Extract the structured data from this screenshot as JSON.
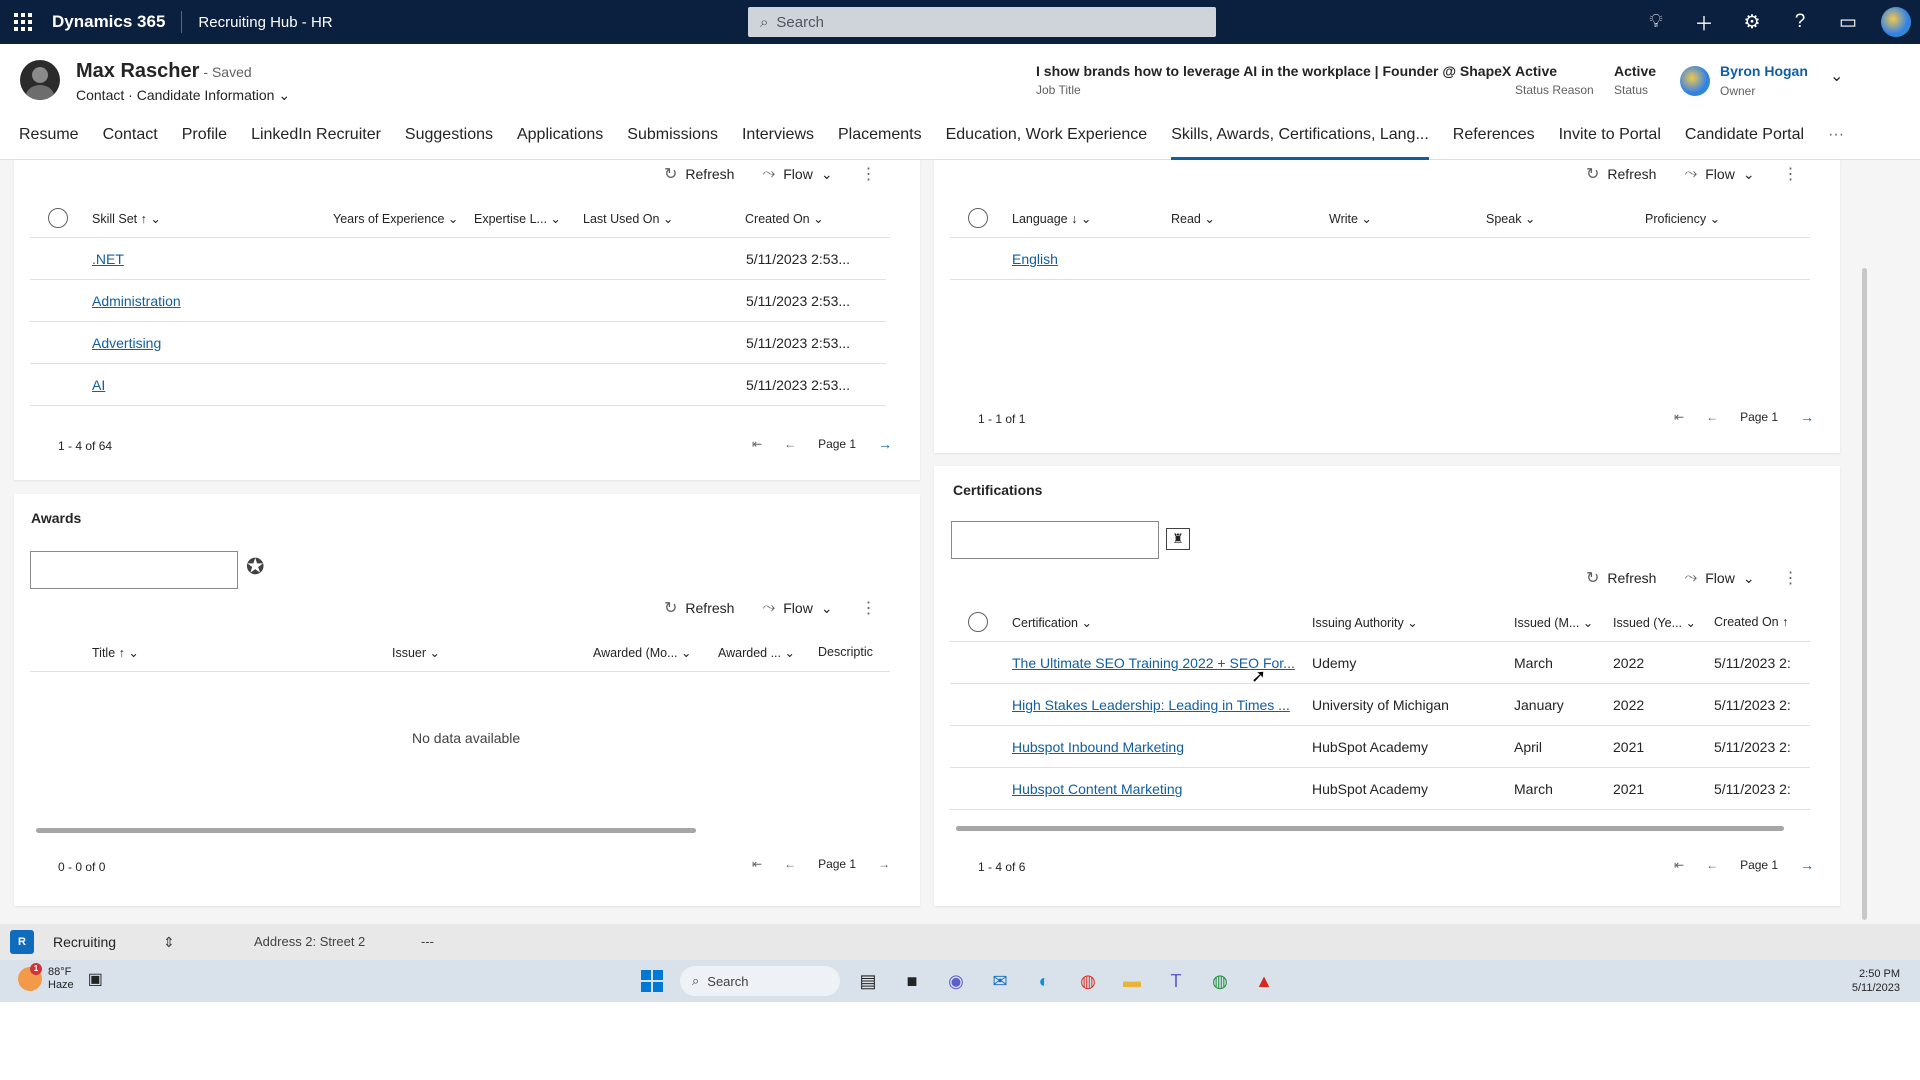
{
  "topbar": {
    "app_name": "Dynamics 365",
    "area": "Recruiting Hub - HR",
    "search_placeholder": "Search"
  },
  "record": {
    "name": "Max Rascher",
    "saved": "- Saved",
    "entity": "Contact",
    "form": "Candidate Information",
    "job_title": "I show brands how to leverage AI in the workplace | Founder @ ShapeX",
    "job_title_label": "Job Title",
    "status_reason": "Active",
    "status_reason_label": "Status Reason",
    "status": "Active",
    "status_label": "Status",
    "owner": "Byron Hogan",
    "owner_label": "Owner"
  },
  "tabs": [
    "Resume",
    "Contact",
    "Profile",
    "LinkedIn Recruiter",
    "Suggestions",
    "Applications",
    "Submissions",
    "Interviews",
    "Placements",
    "Education, Work Experience",
    "Skills, Awards, Certifications, Lang...",
    "References",
    "Invite to Portal",
    "Candidate Portal",
    "···"
  ],
  "commands": {
    "refresh": "Refresh",
    "flow": "Flow"
  },
  "skills": {
    "columns": [
      "Skill Set ↑",
      "Years of Experience",
      "Expertise L...",
      "Last Used On",
      "Created On"
    ],
    "rows": [
      {
        "name": ".NET",
        "created": "5/11/2023 2:53..."
      },
      {
        "name": "Administration",
        "created": "5/11/2023 2:53..."
      },
      {
        "name": "Advertising",
        "created": "5/11/2023 2:53..."
      },
      {
        "name": "AI",
        "created": "5/11/2023 2:53..."
      }
    ],
    "count": "1 - 4 of 64",
    "page": "Page 1"
  },
  "languages": {
    "columns": [
      "Language ↓",
      "Read",
      "Write",
      "Speak",
      "Proficiency"
    ],
    "rows": [
      {
        "name": "English"
      }
    ],
    "count": "1 - 1 of 1",
    "page": "Page 1"
  },
  "awards": {
    "title": "Awards",
    "columns": [
      "Title ↑",
      "Issuer",
      "Awarded (Mo...",
      "Awarded ...",
      "Descriptic"
    ],
    "empty": "No data available",
    "count": "0 - 0 of 0",
    "page": "Page 1"
  },
  "certifications": {
    "title": "Certifications",
    "columns": [
      "Certification",
      "Issuing Authority",
      "Issued (M...",
      "Issued (Ye...",
      "Created On ↑"
    ],
    "rows": [
      {
        "name": "The Ultimate SEO Training 2022 + SEO For...",
        "authority": "Udemy",
        "month": "March",
        "year": "2022",
        "created": "5/11/2023 2:"
      },
      {
        "name": "High Stakes Leadership: Leading in Times ...",
        "authority": "University of Michigan",
        "month": "January",
        "year": "2022",
        "created": "5/11/2023 2:"
      },
      {
        "name": "Hubspot Inbound Marketing",
        "authority": "HubSpot Academy",
        "month": "April",
        "year": "2021",
        "created": "5/11/2023 2:"
      },
      {
        "name": "Hubspot Content Marketing",
        "authority": "HubSpot Academy",
        "month": "March",
        "year": "2021",
        "created": "5/11/2023 2:"
      }
    ],
    "count": "1 - 4 of 6",
    "page": "Page 1"
  },
  "footer": {
    "area_badge": "R",
    "area_name": "Recruiting",
    "address_label": "Address 2: Street 2",
    "address_value": "---"
  },
  "taskbar": {
    "temp": "88°F",
    "weather": "Haze",
    "weather_badge": "1",
    "search": "Search",
    "time": "2:50 PM",
    "date": "5/11/2023"
  }
}
